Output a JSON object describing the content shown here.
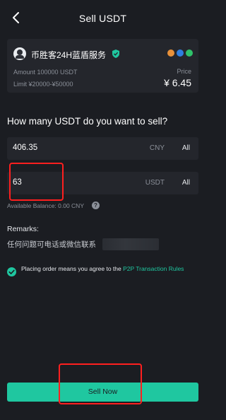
{
  "header": {
    "title": "Sell USDT"
  },
  "ad": {
    "merchant": "币胜客24H蓝盾服务",
    "amount": "Amount 100000 USDT",
    "limit": "Limit ¥20000-¥50000",
    "price_label": "Price",
    "price": "¥ 6.45",
    "pay_methods": [
      {
        "name": "bank-card-icon",
        "color": "#e8913a"
      },
      {
        "name": "alipay-icon",
        "color": "#2f7fe0"
      },
      {
        "name": "wechat-pay-icon",
        "color": "#2fc26a"
      }
    ]
  },
  "form": {
    "question": "How many USDT do you want to sell?",
    "cny": {
      "value": "406.35",
      "unit": "CNY",
      "all": "All"
    },
    "usdt": {
      "value": "63",
      "unit": "USDT",
      "all": "All"
    },
    "balance": "Available Balance: 0.00 CNY"
  },
  "remarks": {
    "label": "Remarks:",
    "text": "任何问题可电话或微信联系"
  },
  "agreement": {
    "text": "Placing order means you agree to the ",
    "link": "P2P Transaction Rules"
  },
  "action": {
    "sell_label": "Sell Now"
  },
  "colors": {
    "background": "#1b1d22",
    "card": "#24262c",
    "accent": "#1fc7a0",
    "annotation": "#ff1f1f"
  }
}
